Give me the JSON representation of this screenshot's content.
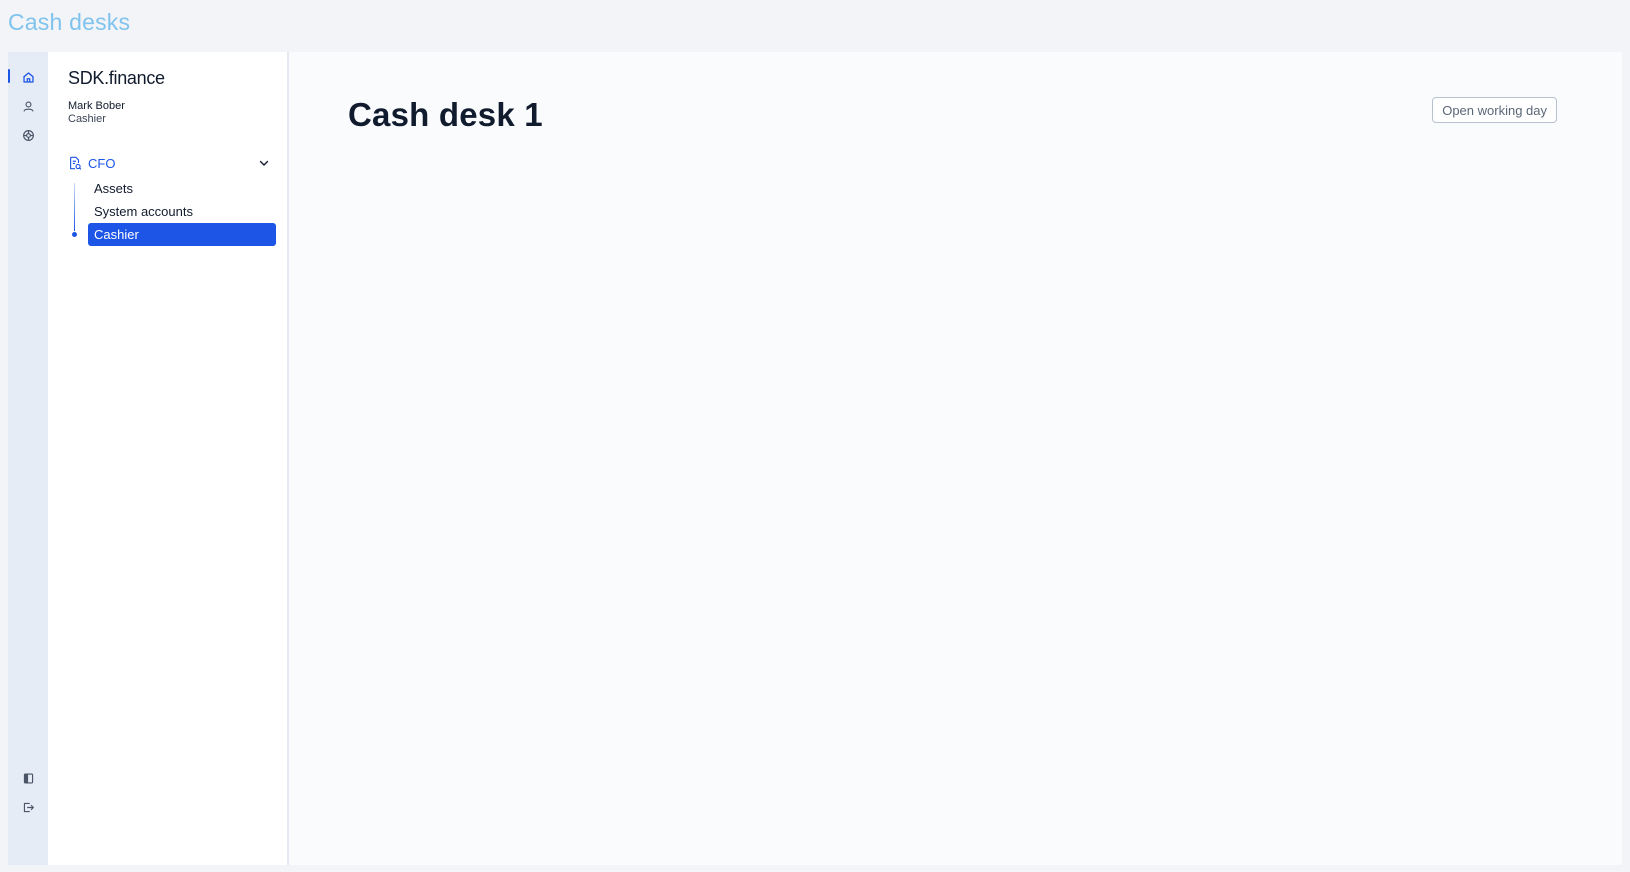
{
  "page": {
    "title": "Cash desks"
  },
  "rail": {
    "top_items": [
      {
        "icon": "home-icon",
        "active": true
      },
      {
        "icon": "user-icon",
        "active": false
      },
      {
        "icon": "settings-icon",
        "active": false
      }
    ],
    "bottom_items": [
      {
        "icon": "panel-toggle-icon"
      },
      {
        "icon": "logout-icon"
      }
    ]
  },
  "sidebar": {
    "brand": "SDK.finance",
    "user": {
      "name": "Mark Bober",
      "role": "Cashier"
    },
    "group": {
      "label": "CFO",
      "icon": "document-icon",
      "expanded": true,
      "items": [
        {
          "label": "Assets",
          "active": false
        },
        {
          "label": "System accounts",
          "active": false
        },
        {
          "label": "Cashier",
          "active": true
        }
      ]
    }
  },
  "main": {
    "title": "Cash desk 1",
    "open_day_button": "Open working day"
  },
  "colors": {
    "accent": "#1d55e6",
    "page_title": "#7fc3ee",
    "rail_bg": "#e6ecf6",
    "text": "#111b2e"
  }
}
